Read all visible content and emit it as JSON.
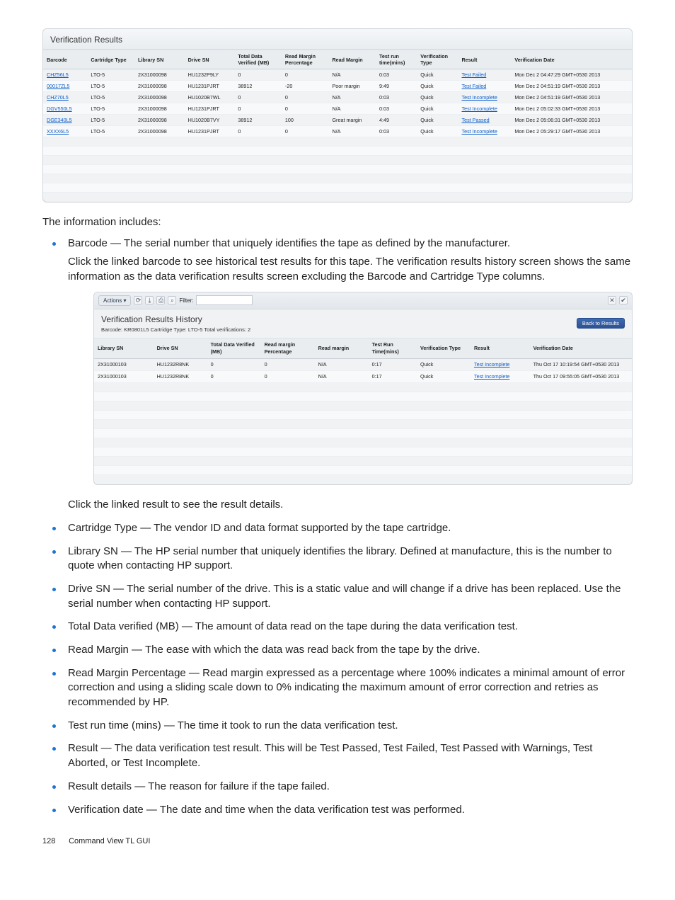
{
  "verification_results": {
    "title": "Verification Results",
    "headers": [
      "Barcode",
      "Cartridge Type",
      "Library SN",
      "Drive SN",
      "Total Data Verified (MB)",
      "Read Margin Percentage",
      "Read Margin",
      "Test run time(mins)",
      "Verification Type",
      "Result",
      "Verification Date"
    ],
    "rows": [
      {
        "barcode": "CHZ56L5",
        "ctype": "LTO-5",
        "lib": "2X31000098",
        "drive": "HU1232P9LY",
        "total": "0",
        "rmp": "0",
        "rm": "N/A",
        "trt": "0:03",
        "vtype": "Quick",
        "result": "Test Failed",
        "date": "Mon Dec 2 04:47:29 GMT+0530 2013"
      },
      {
        "barcode": "00017ZL5",
        "ctype": "LTO-5",
        "lib": "2X31000098",
        "drive": "HU1231PJRT",
        "total": "38912",
        "rmp": "-20",
        "rm": "Poor margin",
        "trt": "9:49",
        "vtype": "Quick",
        "result": "Test Failed",
        "date": "Mon Dec 2 04:51:19 GMT+0530 2013"
      },
      {
        "barcode": "CHZ70L5",
        "ctype": "LTO-5",
        "lib": "2X31000098",
        "drive": "HU1020B7WL",
        "total": "0",
        "rmp": "0",
        "rm": "N/A",
        "trt": "0:03",
        "vtype": "Quick",
        "result": "Test Incomplete",
        "date": "Mon Dec 2 04:51:19 GMT+0530 2013"
      },
      {
        "barcode": "DGV550L5",
        "ctype": "LTO-5",
        "lib": "2X31000098",
        "drive": "HU1231PJRT",
        "total": "0",
        "rmp": "0",
        "rm": "N/A",
        "trt": "0:03",
        "vtype": "Quick",
        "result": "Test Incomplete",
        "date": "Mon Dec 2 05:02:33 GMT+0530 2013"
      },
      {
        "barcode": "DGE340L5",
        "ctype": "LTO-5",
        "lib": "2X31000098",
        "drive": "HU1020B7VY",
        "total": "38912",
        "rmp": "100",
        "rm": "Great margin",
        "trt": "4:49",
        "vtype": "Quick",
        "result": "Test Passed",
        "date": "Mon Dec 2 05:06:31 GMT+0530 2013"
      },
      {
        "barcode": "XXXX6L5",
        "ctype": "LTO-5",
        "lib": "2X31000098",
        "drive": "HU1231PJRT",
        "total": "0",
        "rmp": "0",
        "rm": "N/A",
        "trt": "0:03",
        "vtype": "Quick",
        "result": "Test Incomplete",
        "date": "Mon Dec 2 05:29:17 GMT+0530 2013"
      }
    ]
  },
  "body1": "The information includes:",
  "li_barcode_lead": "Barcode — The serial number that uniquely identifies the tape as defined by the manufacturer.",
  "li_barcode_sub": "Click the linked barcode to see historical test results for this tape. The verification results history screen shows the same information as the data verification results screen excluding the Barcode and Cartridge Type columns.",
  "history_panel": {
    "toolbar": {
      "actions": "Actions ▾",
      "filter_label": "Filter:"
    },
    "title": "Verification Results History",
    "back_btn": "Back to Results",
    "meta": "Barcode: KR0801L5  Cartridge Type: LTO-5  Total verifications: 2",
    "headers": [
      "Library SN",
      "Drive SN",
      "Total Data Verified (MB)",
      "Read margin Percentage",
      "Read margin",
      "Test Run Time(mins)",
      "Verification Type",
      "Result",
      "Verification Date"
    ],
    "rows": [
      {
        "lib": "2X31000103",
        "drive": "HU1232R8NK",
        "total": "0",
        "rmp": "0",
        "rm": "N/A",
        "trt": "0:17",
        "vtype": "Quick",
        "result": "Test Incomplete",
        "date": "Thu Oct 17 10:19:54 GMT+0530 2013"
      },
      {
        "lib": "2X31000103",
        "drive": "HU1232R8NK",
        "total": "0",
        "rmp": "0",
        "rm": "N/A",
        "trt": "0:17",
        "vtype": "Quick",
        "result": "Test Incomplete",
        "date": "Thu Oct 17 09:55:05 GMT+0530 2013"
      }
    ]
  },
  "body2": "Click the linked result to see the result details.",
  "li_cartridge": "Cartridge Type — The vendor ID and data format supported by the tape cartridge.",
  "li_library": "Library SN — The HP serial number that uniquely identifies the library. Defined at manufacture, this is the number to quote when contacting HP support.",
  "li_drive": "Drive SN — The serial number of the drive. This is a static value and will change if a drive has been replaced. Use the serial number when contacting HP support.",
  "li_totaldata": "Total Data verified (MB) — The amount of data read on the tape during the data verification test.",
  "li_readmargin": "Read Margin — The ease with which the data was read back from the tape by the drive.",
  "li_rmp": "Read Margin Percentage — Read margin expressed as a percentage where 100% indicates a minimal amount of error correction and using a sliding scale down to 0% indicating the maximum amount of error correction and retries as recommended by HP.",
  "li_testrun": "Test run time (mins) — The time it took to run the data verification test.",
  "li_result": "Result — The data verification test result. This will be Test Passed, Test Failed, Test Passed with Warnings, Test Aborted, or Test Incomplete.",
  "li_resultdetails": "Result details — The reason for failure if the tape failed.",
  "li_vdate": "Verification date — The date and time when the data verification test was performed.",
  "footer": {
    "page": "128",
    "section": "Command View TL GUI"
  }
}
